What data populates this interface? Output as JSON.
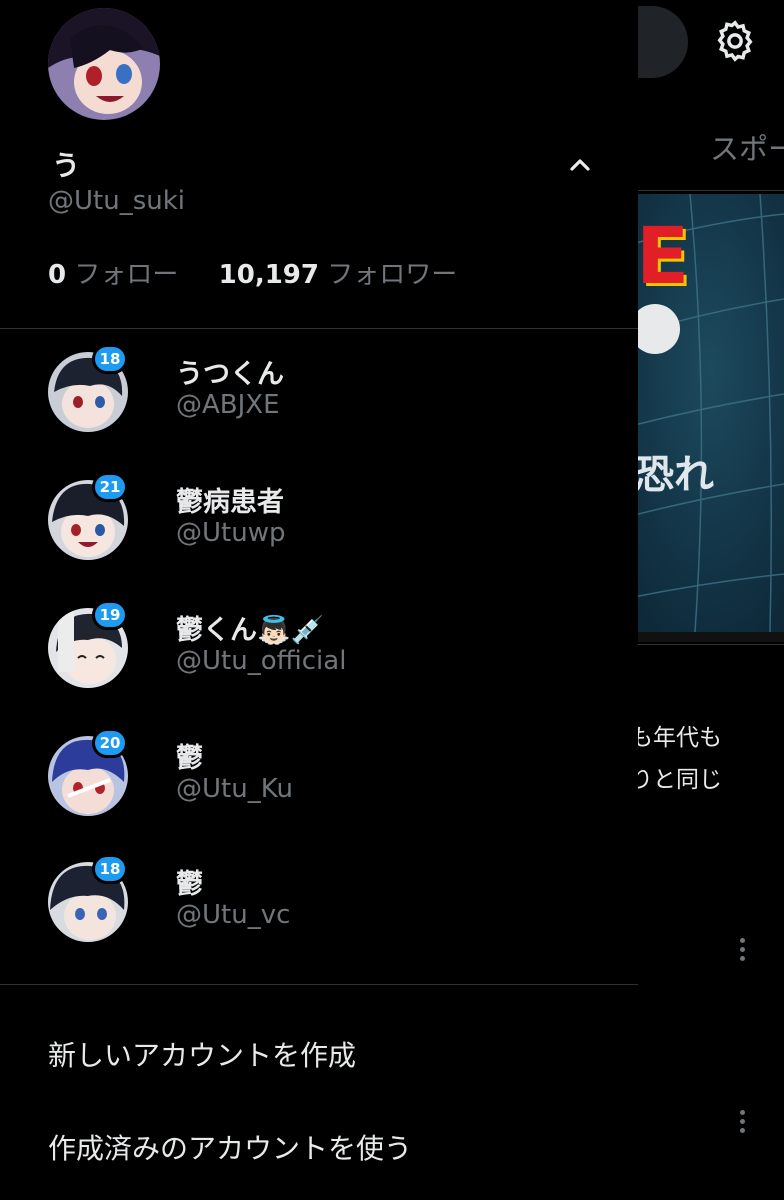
{
  "background": {
    "tabs": [
      "ス",
      "スポー"
    ],
    "promo_big_text": "E",
    "promo_text": "恐れ",
    "snippet_lines": [
      "も年代も",
      "りと同じ"
    ]
  },
  "profile": {
    "name": "う",
    "handle": "@Utu_suki",
    "following_count": "0",
    "following_label": "フォロー",
    "followers_count": "10,197",
    "followers_label": "フォロワー"
  },
  "accounts": [
    {
      "name": "うつくん",
      "handle": "@ABJXE",
      "badge": "18"
    },
    {
      "name": "鬱病患者",
      "handle": "@Utuwp",
      "badge": "21"
    },
    {
      "name": "鬱くん👼🏻💉",
      "handle": "@Utu_official",
      "badge": "19"
    },
    {
      "name": "鬱",
      "handle": "@Utu_Ku",
      "badge": "20"
    },
    {
      "name": "鬱",
      "handle": "@Utu_vc",
      "badge": "18"
    }
  ],
  "menu": {
    "create_account": "新しいアカウントを作成",
    "use_existing": "作成済みのアカウントを使う"
  },
  "colors": {
    "background": "#000000",
    "text_primary": "#e7e9ea",
    "text_secondary": "#71767b",
    "divider": "#2f3336",
    "badge": "#1d9bf0"
  }
}
